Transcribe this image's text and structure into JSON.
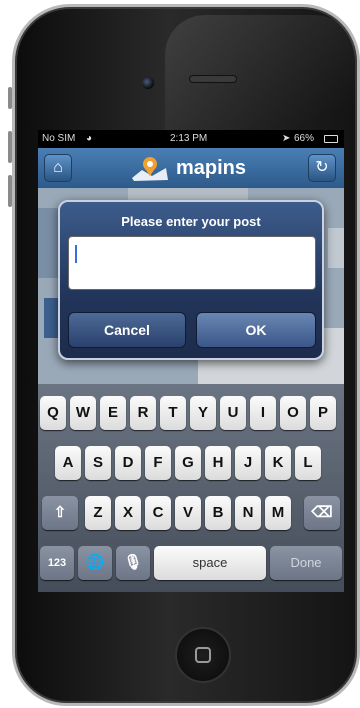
{
  "status": {
    "carrier": "No SIM",
    "time": "2:13 PM",
    "battery": "66%"
  },
  "app": {
    "name": "mapins",
    "home_icon": "home-icon",
    "refresh_icon": "refresh-icon"
  },
  "dialog": {
    "title": "Please enter your post",
    "input_value": "",
    "cancel_label": "Cancel",
    "ok_label": "OK"
  },
  "keyboard": {
    "row1": [
      "Q",
      "W",
      "E",
      "R",
      "T",
      "Y",
      "U",
      "I",
      "O",
      "P"
    ],
    "row2": [
      "A",
      "S",
      "D",
      "F",
      "G",
      "H",
      "J",
      "K",
      "L"
    ],
    "row3": [
      "Z",
      "X",
      "C",
      "V",
      "B",
      "N",
      "M"
    ],
    "numbers_label": "123",
    "space_label": "space",
    "done_label": "Done"
  },
  "colors": {
    "navbar": "#2c5a8a",
    "dialog": "#22355a",
    "keyboard": "#454d5a"
  }
}
